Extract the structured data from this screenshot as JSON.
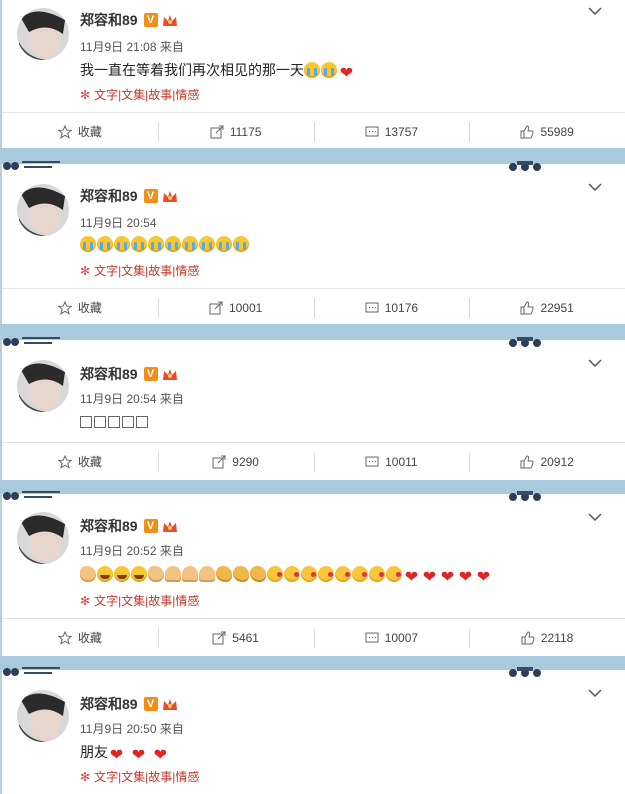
{
  "posts": [
    {
      "author": "郑容和89",
      "verified": "V",
      "time": "11月9日 21:08",
      "from": "来自",
      "text": "我一直在等着我们再次相见的那一天",
      "source": "文字|文集|故事|情感",
      "actions": {
        "fav": "收藏",
        "repost": "11175",
        "comment": "13757",
        "like": "55989"
      }
    },
    {
      "author": "郑容和89",
      "verified": "V",
      "time": "11月9日 20:54",
      "from": "",
      "text": "",
      "source": "文字|文集|故事|情感",
      "actions": {
        "fav": "收藏",
        "repost": "10001",
        "comment": "10176",
        "like": "22951"
      }
    },
    {
      "author": "郑容和89",
      "verified": "V",
      "time": "11月9日 20:54",
      "from": "来自",
      "text": "",
      "source": "",
      "actions": {
        "fav": "收藏",
        "repost": "9290",
        "comment": "10011",
        "like": "20912"
      }
    },
    {
      "author": "郑容和89",
      "verified": "V",
      "time": "11月9日 20:52",
      "from": "来自",
      "text": "",
      "source": "文字|文集|故事|情感",
      "actions": {
        "fav": "收藏",
        "repost": "5461",
        "comment": "10007",
        "like": "22118"
      }
    },
    {
      "author": "郑容和89",
      "verified": "V",
      "time": "11月9日 20:50",
      "from": "来自",
      "text": "朋友",
      "source": "文字|文集|故事|情感",
      "actions": {}
    }
  ],
  "colors": {
    "background": "#a9c9dc",
    "source_red": "#c0392b",
    "badge_orange": "#f28d1a",
    "heart_red": "#e02424"
  }
}
